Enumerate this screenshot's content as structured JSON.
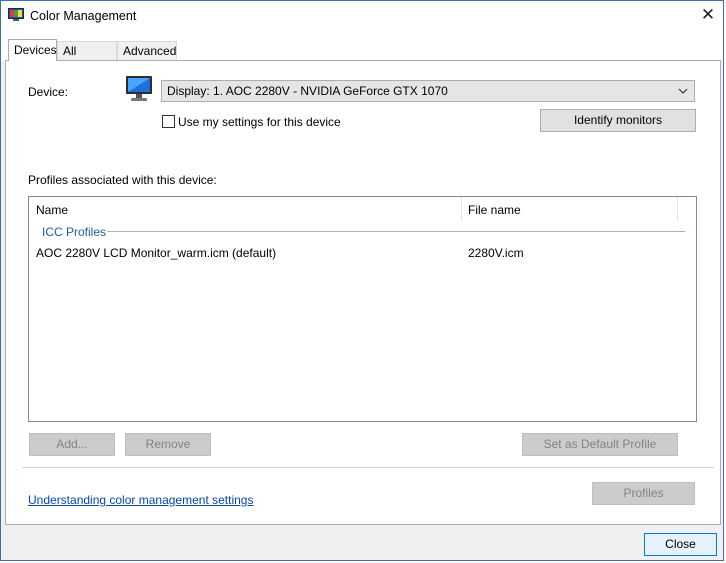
{
  "window": {
    "title": "Color Management"
  },
  "tabs": [
    {
      "label": "Devices"
    },
    {
      "label": "All Profiles"
    },
    {
      "label": "Advanced"
    }
  ],
  "device": {
    "label": "Device:",
    "selected": "Display: 1. AOC 2280V - NVIDIA GeForce GTX 1070",
    "use_my_settings_label": "Use my settings for this device",
    "use_my_settings_checked": false,
    "identify_button": "Identify monitors"
  },
  "profiles": {
    "section_label": "Profiles associated with this device:",
    "columns": [
      "Name",
      "File name"
    ],
    "group_label": "ICC Profiles",
    "rows": [
      {
        "name": "AOC 2280V LCD Monitor_warm.icm (default)",
        "file": "2280V.icm"
      }
    ]
  },
  "actions": {
    "add": "Add...",
    "remove": "Remove",
    "set_default": "Set as Default Profile"
  },
  "footer": {
    "link": "Understanding color management settings",
    "profiles_button": "Profiles",
    "close_button": "Close"
  },
  "colors": {
    "link": "#0645ad",
    "accent": "#0078d7",
    "group_header": "#1f5c9e"
  }
}
